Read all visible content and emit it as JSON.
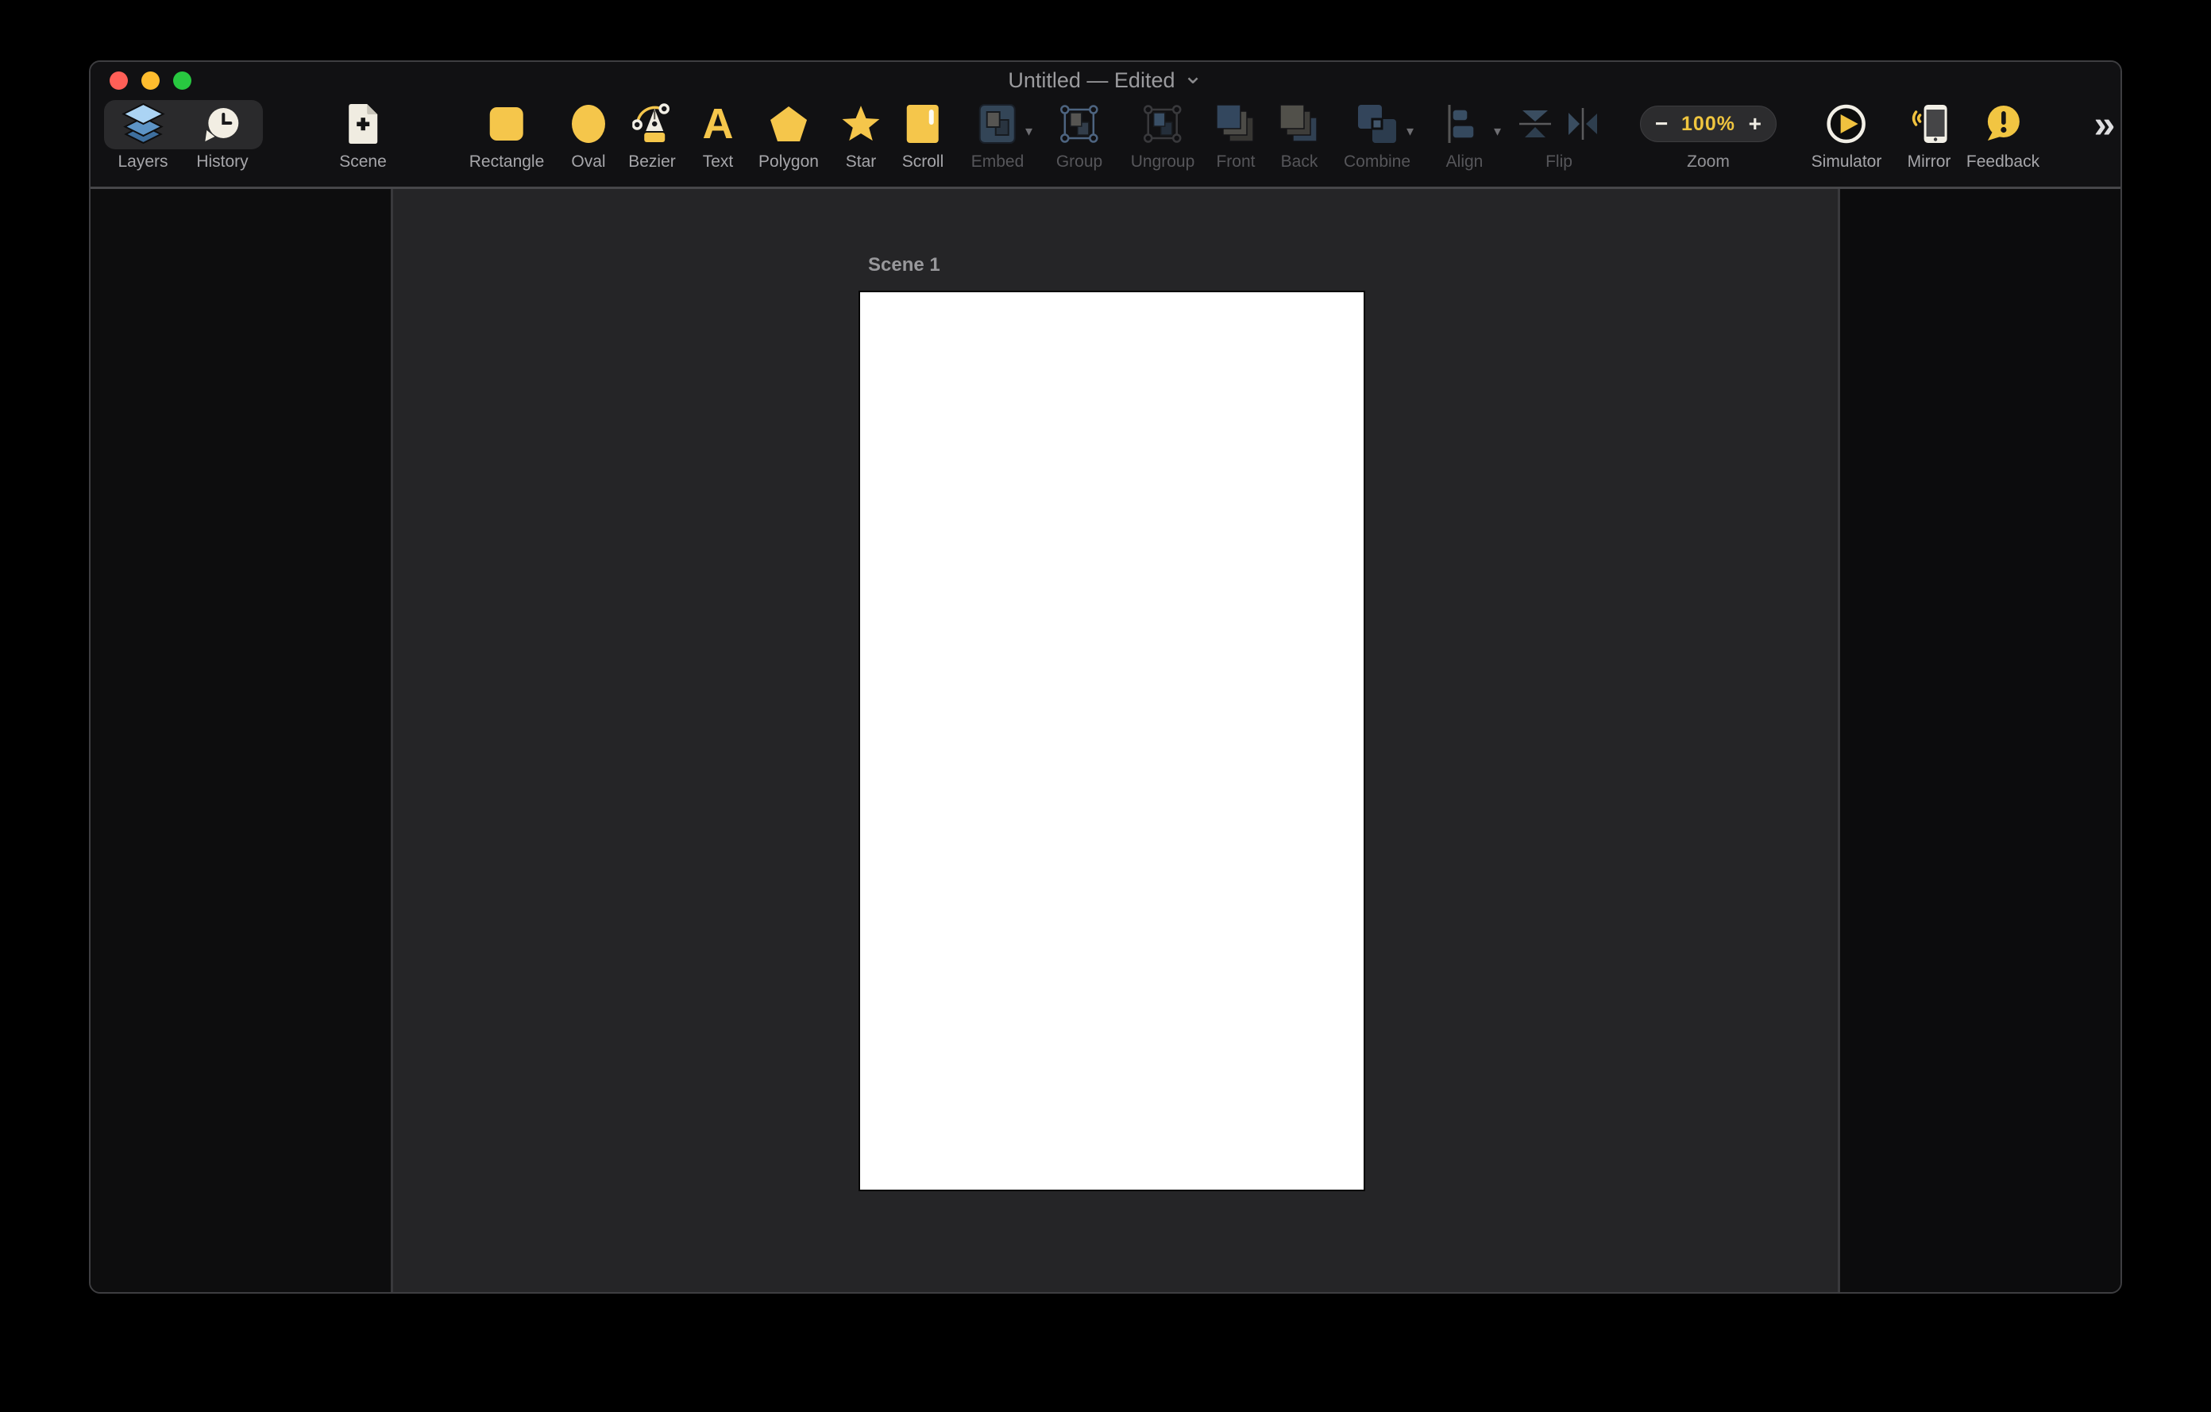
{
  "window": {
    "title": "Untitled — Edited",
    "traffic_lights": {
      "close": "#FF5F57",
      "minimize": "#FEBC2E",
      "zoom": "#28C840"
    }
  },
  "icons": {
    "title_chevron": "⌄",
    "dropdown_arrow": "▾",
    "overflow_chevrons": "»",
    "zoom_out": "−",
    "zoom_in": "+"
  },
  "toolbar": {
    "panel_toggles": {
      "layers": "Layers",
      "history": "History"
    },
    "scene": {
      "label": "Scene"
    },
    "shape_tools": {
      "rectangle": "Rectangle",
      "oval": "Oval",
      "bezier": "Bezier",
      "text": "Text",
      "text_glyph": "A",
      "polygon": "Polygon",
      "star": "Star",
      "scroll": "Scroll"
    },
    "arrange_tools": {
      "embed": "Embed",
      "group": "Group",
      "ungroup": "Ungroup",
      "front": "Front",
      "back": "Back",
      "combine": "Combine",
      "align": "Align",
      "flip": "Flip"
    },
    "zoom": {
      "label": "Zoom",
      "value": "100%"
    },
    "run_tools": {
      "simulator": "Simulator",
      "mirror": "Mirror",
      "feedback": "Feedback"
    }
  },
  "canvas": {
    "scene_title": "Scene 1"
  },
  "colors": {
    "accent_yellow": "#F5C64B",
    "zoom_value_yellow": "#EFC53F",
    "slate_blue": "#54769A",
    "canvas_background": "#252527",
    "panel_background": "#0D0D0E"
  }
}
